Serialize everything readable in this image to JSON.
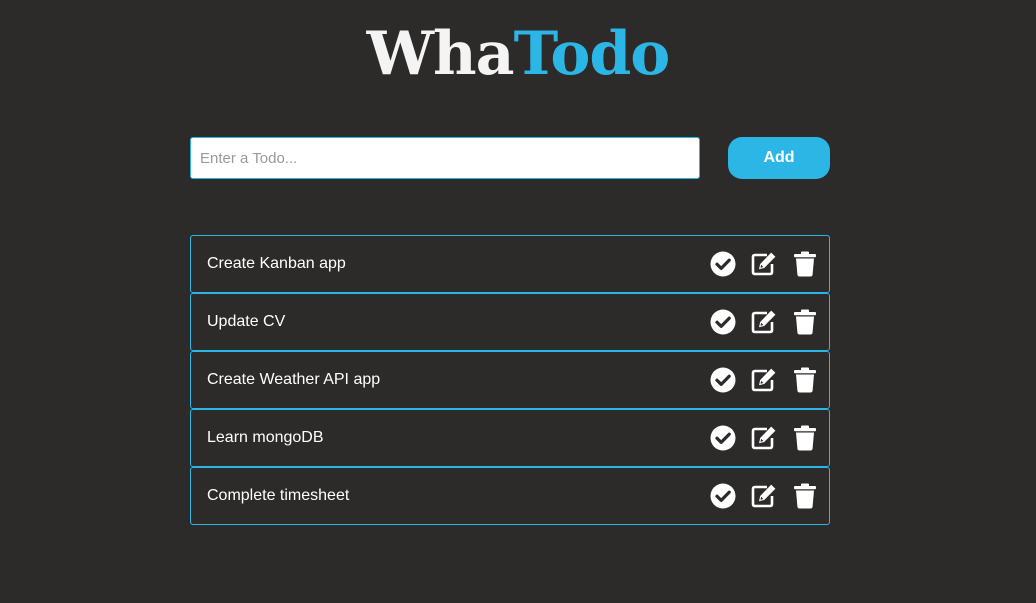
{
  "header": {
    "logo_part1": "Wha",
    "logo_part2": "Todo"
  },
  "form": {
    "input_value": "",
    "input_placeholder": "Enter a Todo...",
    "add_label": "Add"
  },
  "todos": [
    {
      "text": "Create Kanban app"
    },
    {
      "text": "Update CV"
    },
    {
      "text": "Create Weather API app"
    },
    {
      "text": "Learn mongoDB"
    },
    {
      "text": "Complete timesheet"
    }
  ],
  "icons": {
    "complete": "check-circle-icon",
    "edit": "edit-icon",
    "delete": "trash-icon"
  },
  "colors": {
    "background": "#2d2b2a",
    "accent": "#2cb6e6",
    "text": "#ffffff"
  }
}
